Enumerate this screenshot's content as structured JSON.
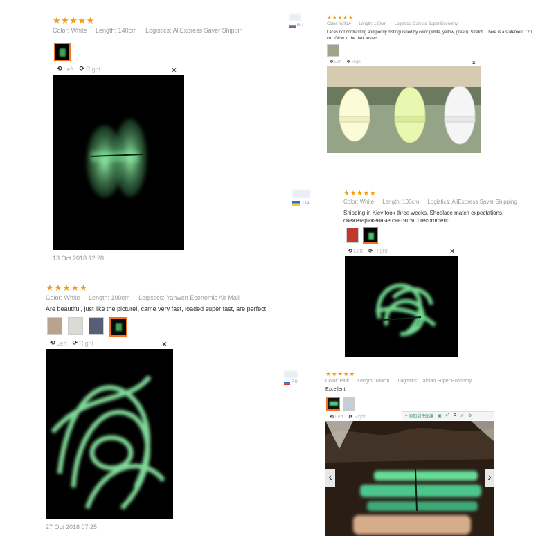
{
  "review1": {
    "stars": "★★★★★",
    "color": "Color: White",
    "length": "Length: 140cm",
    "logistics": "Logistics: AliExpress Saver Shipping",
    "rotate_left": "Left",
    "rotate_right": "Right",
    "close": "×",
    "date": "13 Oct 2018 12:28"
  },
  "review2": {
    "stars": "★★★★★",
    "color": "Color: White",
    "length": "Length: 100cm",
    "logistics": "Logistics: Yanwen Economic Air Mail",
    "comment": "Are beautiful, just like the picture!, came very fast, loaded super fast, are perfect",
    "rotate_left": "Left",
    "rotate_right": "Right",
    "close": "×",
    "date": "27 Oct 2018 07:25"
  },
  "review3": {
    "country": "RU",
    "stars": "★★★★★",
    "color": "Color: Yellow",
    "length": "Length: 120cm",
    "logistics": "Logistics: Cainiao Super Economy",
    "comment": "Laces not contrasting and poorly distinguished by color (white, yellow, green). Stretch. There is a statement 120 cm. Glow in the dark tested.",
    "rotate_left": "Left",
    "rotate_right": "Right",
    "close": "×"
  },
  "review4": {
    "country": "UA",
    "stars": "★★★★★",
    "color": "Color: White",
    "length": "Length: 100cm",
    "logistics": "Logistics: AliExpress Saver Shipping",
    "comment": "Shipping in Kiev took three weeks. Shoelace match expectations, свежезаряженные светятся. I recommend.",
    "rotate_left": "Left",
    "rotate_right": "Right",
    "close": "×"
  },
  "review5": {
    "country": "RU",
    "stars": "★★★★★",
    "color": "Color: Pink",
    "length": "Length: 100cm",
    "logistics": "Logistics: Cainiao Super Economy",
    "comment": "Excellent",
    "rotate_left": "Left",
    "rotate_right": "Right",
    "toolbar_add": "+ 添加到快图编",
    "prev": "‹",
    "next": "›"
  },
  "colors": {
    "star": "#f39c12",
    "accent": "#f57224",
    "glow_green": "#7dff9a",
    "dark": "#000000"
  }
}
